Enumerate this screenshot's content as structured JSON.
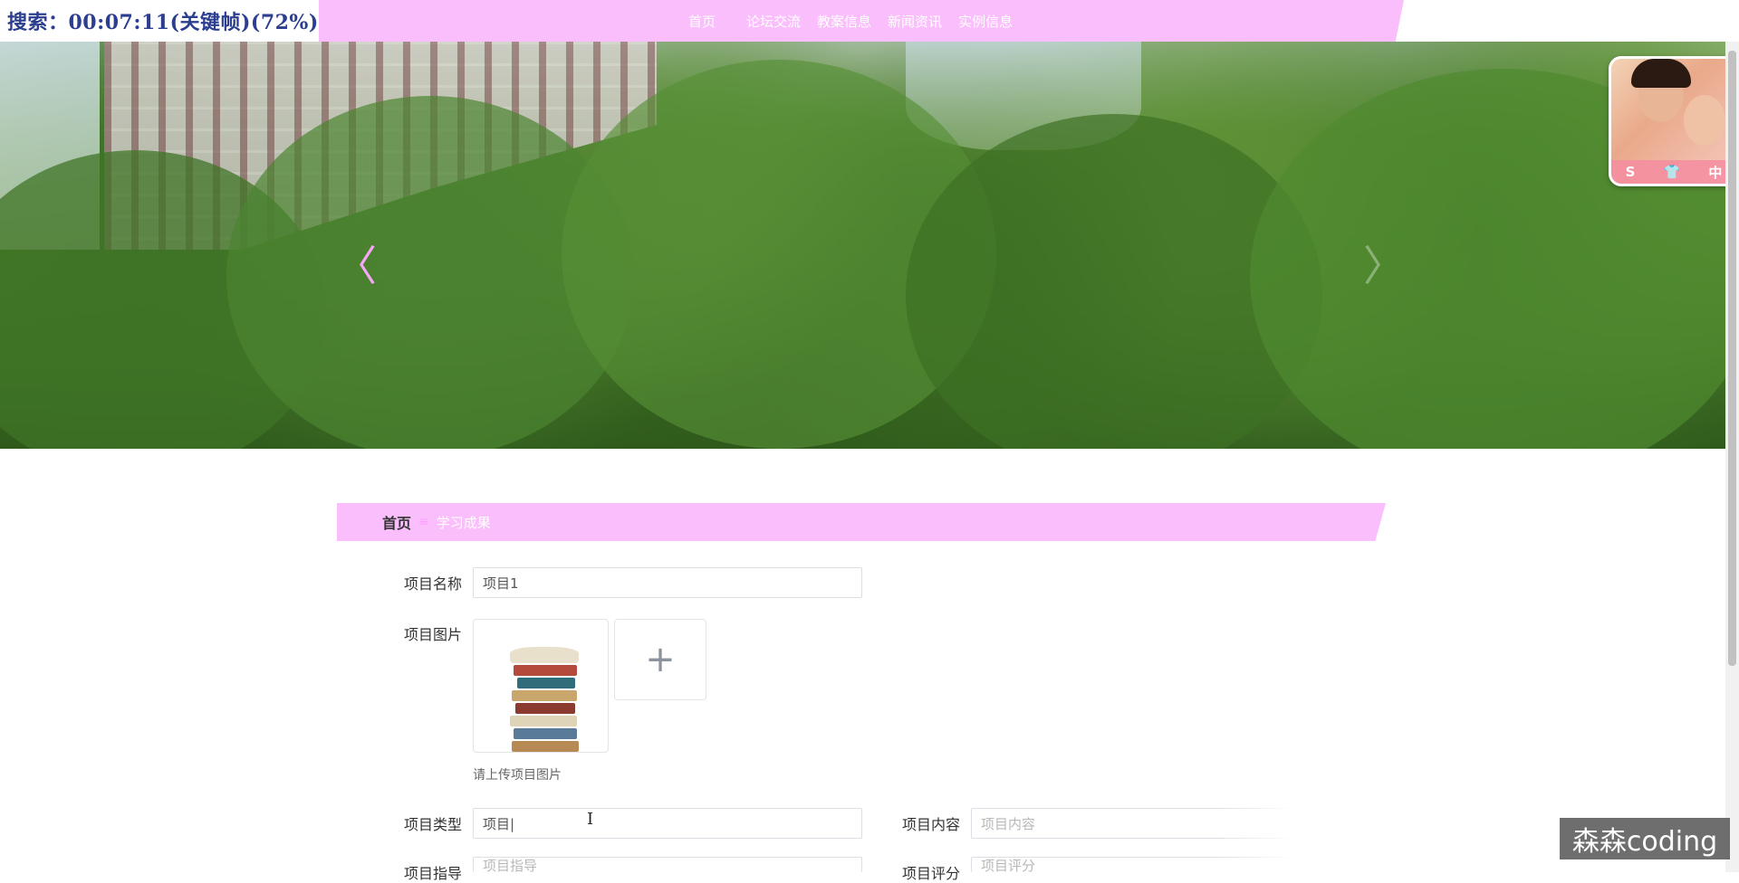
{
  "overlay": {
    "text": "搜索：00:07:11(关键帧)(72%)"
  },
  "nav": {
    "items": [
      "首页",
      "论坛交流",
      "教案信息",
      "新闻资讯",
      "实例信息"
    ]
  },
  "banner": {
    "prev_arrow": "〈",
    "next_arrow": "〉"
  },
  "avatar": {
    "badges": [
      "S",
      "👕",
      "中"
    ]
  },
  "breadcrumb": {
    "home": "首页",
    "separator": "≡",
    "current": "学习成果"
  },
  "form": {
    "name_label": "项目名称",
    "name_value": "项目1",
    "image_label": "项目图片",
    "upload_plus": "+",
    "upload_hint": "请上传项目图片",
    "type_label": "项目类型",
    "type_value": "项目|",
    "content_label": "项目内容",
    "content_placeholder": "项目内容",
    "guide_label": "项目指导",
    "guide_placeholder": "项目指导",
    "review_label": "项目评分",
    "review_placeholder": "项目评分"
  },
  "watermark": {
    "text": "森森coding"
  },
  "colors": {
    "accent_pink": "#fbbefc",
    "nav_text": "#ffffff"
  }
}
